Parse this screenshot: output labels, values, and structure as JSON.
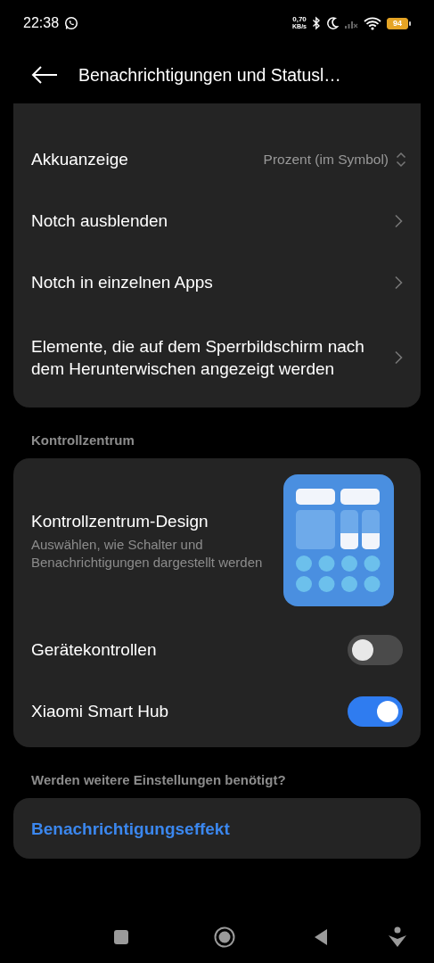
{
  "status_bar": {
    "time": "22:38",
    "net_speed": "0,70",
    "net_unit": "KB/s",
    "battery": "94"
  },
  "header": {
    "title": "Benachrichtigungen und Statusl…"
  },
  "sections": [
    {
      "items": [
        {
          "kind": "select",
          "label": "Akkuanzeige",
          "value": "Prozent (im Symbol)"
        },
        {
          "kind": "link",
          "label": "Notch ausblenden"
        },
        {
          "kind": "link",
          "label": "Notch in einzelnen Apps"
        },
        {
          "kind": "link",
          "label": "Elemente, die auf dem Sperrbildschirm nach dem Herunterwischen angezeigt werden"
        }
      ]
    },
    {
      "title": "Kontrollzentrum",
      "items": [
        {
          "kind": "design",
          "label": "Kontrollzentrum-Design",
          "description": "Auswählen, wie Schalter und Benachrichtigungen dargestellt werden"
        },
        {
          "kind": "toggle",
          "label": "Gerätekontrollen",
          "on": false
        },
        {
          "kind": "toggle",
          "label": "Xiaomi Smart Hub",
          "on": true
        }
      ]
    },
    {
      "title": "Werden weitere Einstellungen benötigt?",
      "items": [
        {
          "kind": "action",
          "label": "Benachrichtigungseffekt"
        }
      ]
    }
  ]
}
